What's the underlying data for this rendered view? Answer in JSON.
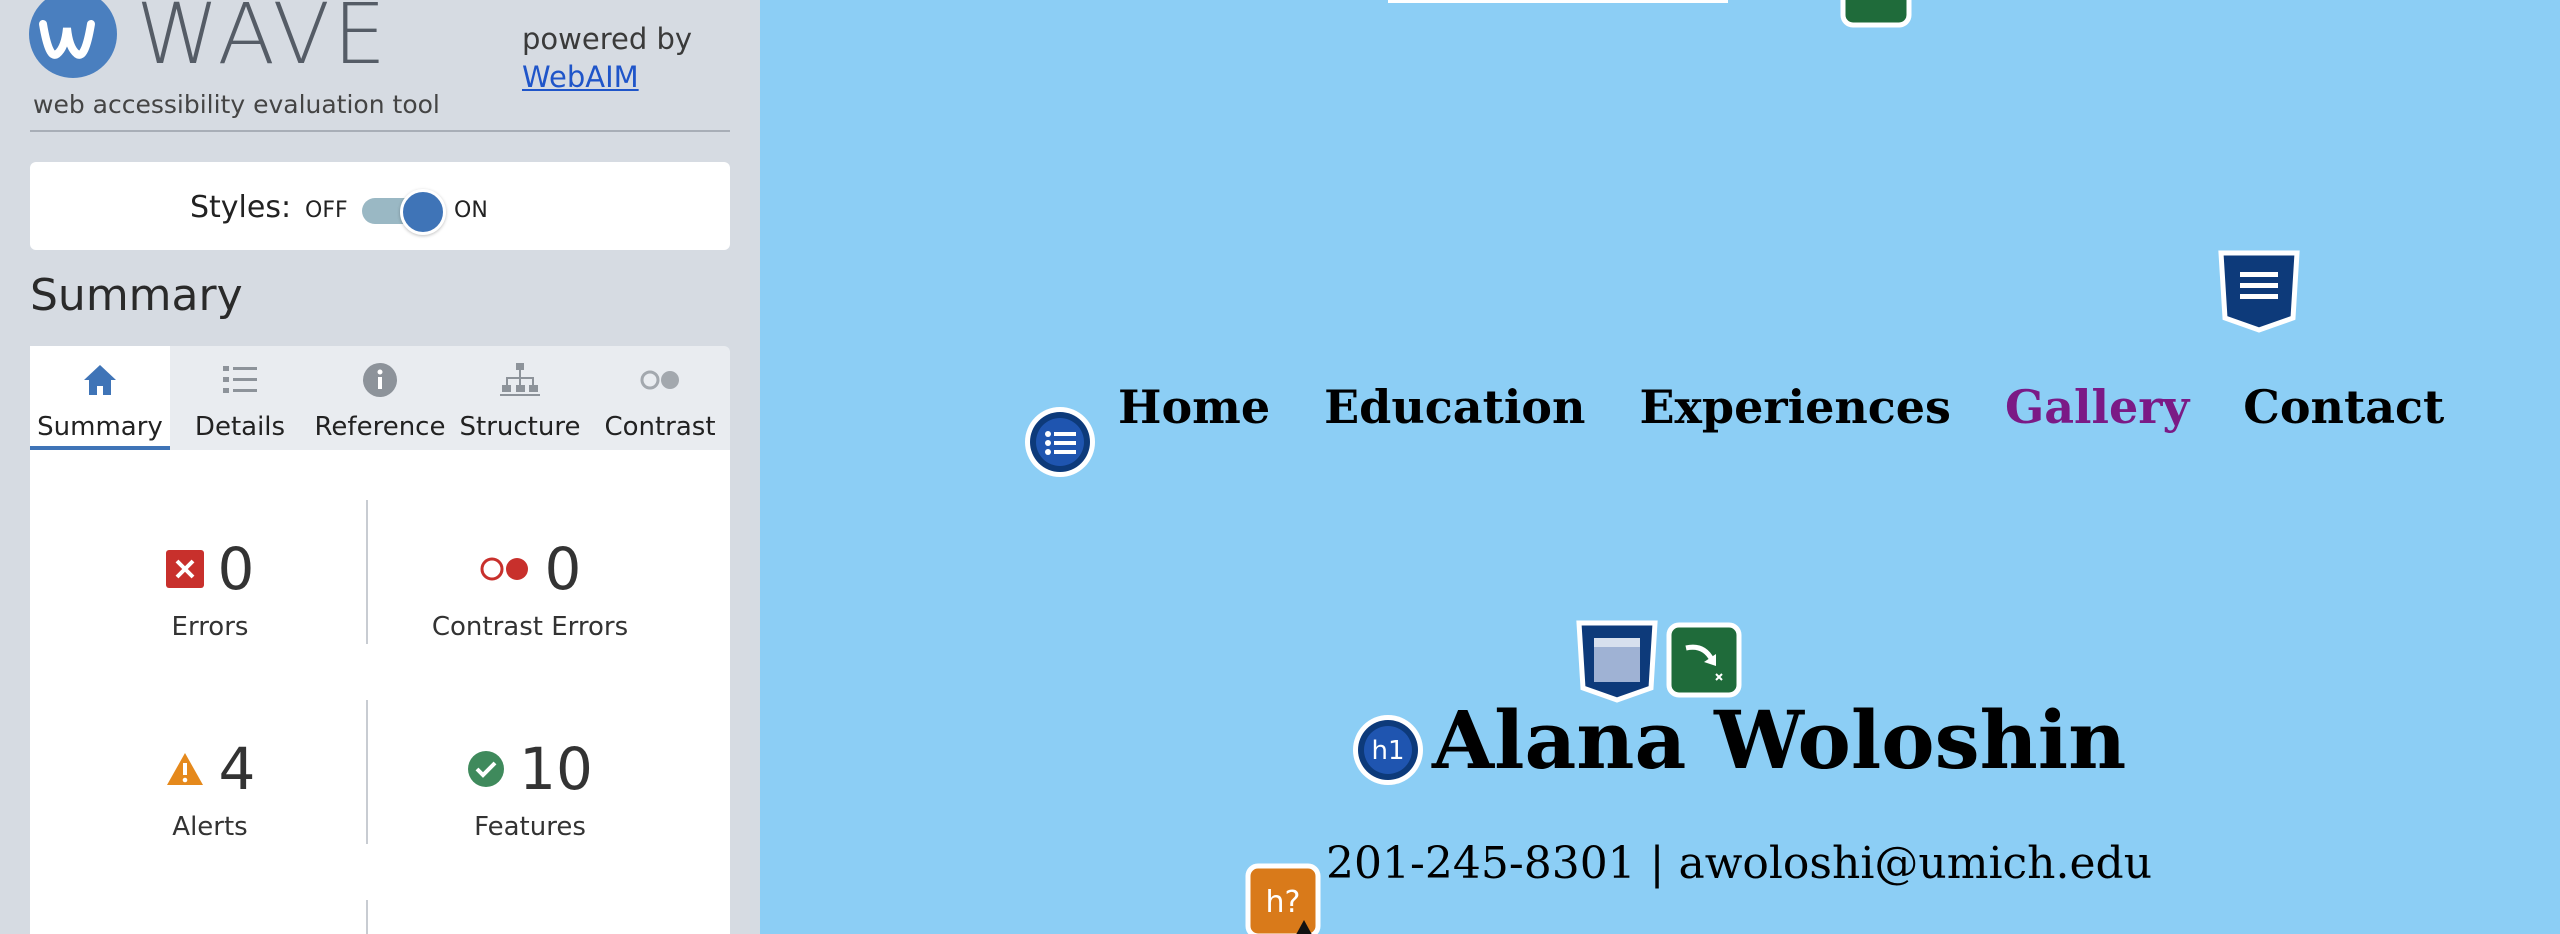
{
  "wave": {
    "logo_text": "WAVE",
    "tagline": "web accessibility evaluation tool",
    "powered_by": "powered by",
    "webaim_link": "WebAIM",
    "styles": {
      "label": "Styles:",
      "off": "OFF",
      "on": "ON",
      "state": "on"
    },
    "summary_heading": "Summary",
    "tabs": [
      {
        "label": "Summary",
        "icon": "home-icon",
        "active": true
      },
      {
        "label": "Details",
        "icon": "list-icon"
      },
      {
        "label": "Reference",
        "icon": "info-icon"
      },
      {
        "label": "Structure",
        "icon": "structure-icon"
      },
      {
        "label": "Contrast",
        "icon": "contrast-icon"
      }
    ],
    "stats": {
      "errors": {
        "value": "0",
        "label": "Errors",
        "icon": "error-x-icon",
        "color": "#c8302c"
      },
      "contrast_errors": {
        "value": "0",
        "label": "Contrast Errors",
        "icon": "contrast-error-icon",
        "color": "#c8302c"
      },
      "alerts": {
        "value": "4",
        "label": "Alerts",
        "icon": "alert-triangle-icon",
        "color": "#e5891c"
      },
      "features": {
        "value": "10",
        "label": "Features",
        "icon": "check-circle-icon",
        "color": "#3f8a5c"
      }
    }
  },
  "page": {
    "nav": [
      "Home",
      "Education",
      "Experiences",
      "Gallery",
      "Contact"
    ],
    "heading": "Alana Woloshin",
    "contact_line": "201-245-8301 | awoloshi@umich.edu",
    "badges": {
      "h1": "h1",
      "possible_heading": "h?"
    },
    "colors": {
      "background": "#8ccef5",
      "visited_link": "#7b1a86",
      "wave_blue": "#0d3a7a",
      "wave_green": "#1f6b3a",
      "wave_orange": "#d97a1a"
    }
  }
}
